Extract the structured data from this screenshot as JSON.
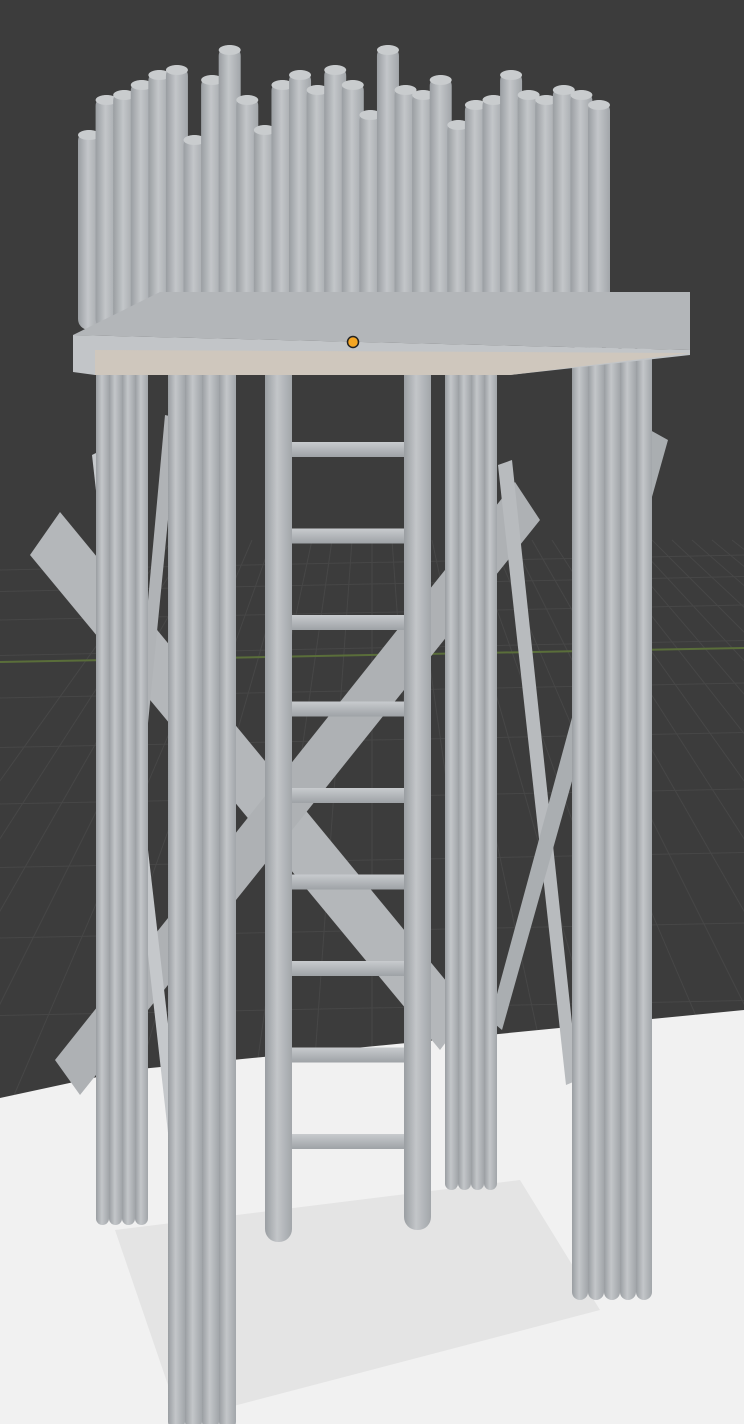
{
  "viewport": {
    "background": "#3c3c3c",
    "grid_color": "#464646",
    "x_axis_color": "#5a6e3a",
    "floor_color": "#f2f2f2",
    "model_color": "#b9bcbf",
    "origin_color": "#f5a623"
  },
  "model": {
    "ladder_rungs": 9,
    "palisade_poles": 30
  }
}
